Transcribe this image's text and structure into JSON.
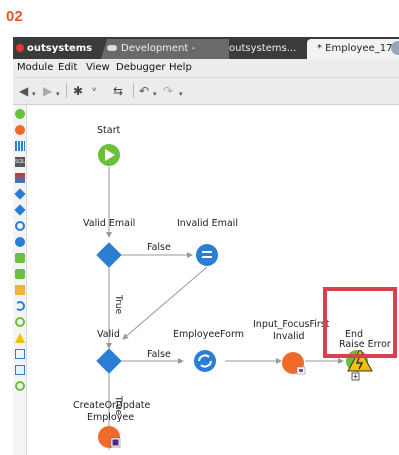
{
  "step_number": "02",
  "tabs": {
    "logo": "outsystems",
    "development": "Development -",
    "outsystems": "outsystems...",
    "employee": "* Employee_17",
    "close_glyph": "×"
  },
  "menu": [
    "Module",
    "Edit",
    "View",
    "Debugger",
    "Help"
  ],
  "toolbar_icons": [
    "back-icon",
    "forward-icon",
    "settings-icon",
    "workflow-icon",
    "publish-icon",
    "undo-icon",
    "redo-icon"
  ],
  "flow": {
    "start": "Start",
    "valid_email": "Valid Email",
    "invalid_email": "Invalid Email",
    "false_1": "False",
    "true_1": "True",
    "valid": "Valid",
    "employee_form": "EmployeeForm",
    "false_2": "False",
    "input_focus_line1": "Input_FocusFirst",
    "input_focus_line2": "Invalid",
    "end": "End",
    "raise_error": "Raise Error",
    "true_2": "True",
    "create_line1": "CreateOrUpdate",
    "create_line2": "Employee"
  },
  "colors": {
    "step_label": "#e4572e",
    "highlight": "#d9414c",
    "start_green": "#6abf3b",
    "decision_blue": "#2a7fd4",
    "orange": "#ef6a2b"
  }
}
